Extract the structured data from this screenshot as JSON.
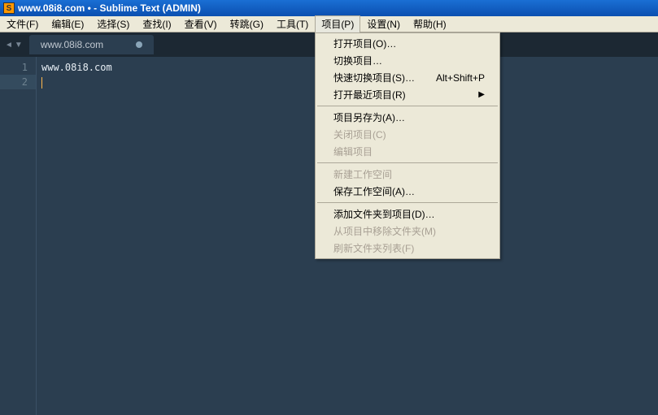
{
  "titlebar": {
    "text": "www.08i8.com • - Sublime Text (ADMIN)"
  },
  "menubar": {
    "items": [
      {
        "label": "文件(F)"
      },
      {
        "label": "编辑(E)"
      },
      {
        "label": "选择(S)"
      },
      {
        "label": "查找(I)"
      },
      {
        "label": "查看(V)"
      },
      {
        "label": "转跳(G)"
      },
      {
        "label": "工具(T)"
      },
      {
        "label": "项目(P)"
      },
      {
        "label": "设置(N)"
      },
      {
        "label": "帮助(H)"
      }
    ],
    "activeIndex": 7
  },
  "tabbar": {
    "prev": "◄",
    "next": "▼",
    "tab": {
      "label": "www.08i8.com"
    }
  },
  "editor": {
    "lines": [
      {
        "num": "1",
        "text": "www.08i8.com"
      },
      {
        "num": "2",
        "text": ""
      }
    ],
    "currentLine": 1
  },
  "dropdown": {
    "groups": [
      [
        {
          "label": "打开项目(O)…",
          "disabled": false
        },
        {
          "label": "切换项目…",
          "disabled": false
        },
        {
          "label": "快速切换项目(S)…",
          "accel": "Alt+Shift+P",
          "disabled": false
        },
        {
          "label": "打开最近项目(R)",
          "submenu": true,
          "disabled": false
        }
      ],
      [
        {
          "label": "项目另存为(A)…",
          "disabled": false
        },
        {
          "label": "关闭项目(C)",
          "disabled": true
        },
        {
          "label": "编辑项目",
          "disabled": true
        }
      ],
      [
        {
          "label": "新建工作空间",
          "disabled": true
        },
        {
          "label": "保存工作空间(A)…",
          "disabled": false
        }
      ],
      [
        {
          "label": "添加文件夹到项目(D)…",
          "disabled": false
        },
        {
          "label": "从项目中移除文件夹(M)",
          "disabled": true
        },
        {
          "label": "刷新文件夹列表(F)",
          "disabled": true
        }
      ]
    ],
    "subIndicator": "▶"
  }
}
